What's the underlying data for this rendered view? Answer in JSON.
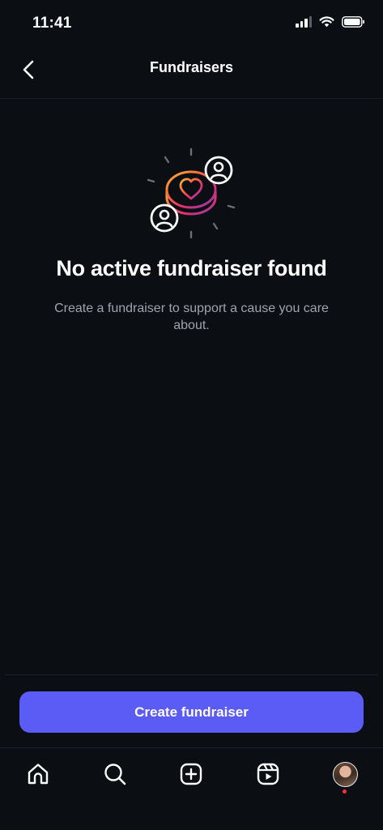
{
  "status_bar": {
    "time": "11:41"
  },
  "header": {
    "title": "Fundraisers"
  },
  "empty_state": {
    "title": "No active fundraiser found",
    "subtitle": "Create a fundraiser to support a cause you care about."
  },
  "actions": {
    "create_label": "Create fundraiser"
  },
  "tab_bar": {
    "items": [
      {
        "icon": "home-icon"
      },
      {
        "icon": "search-icon"
      },
      {
        "icon": "create-post-icon"
      },
      {
        "icon": "reels-icon"
      },
      {
        "icon": "profile-avatar"
      }
    ]
  },
  "colors": {
    "background": "#0b0f14",
    "primary_button": "#5b5cf6",
    "subtitle_text": "#a0a4aa",
    "notification_dot": "#ff3040"
  }
}
